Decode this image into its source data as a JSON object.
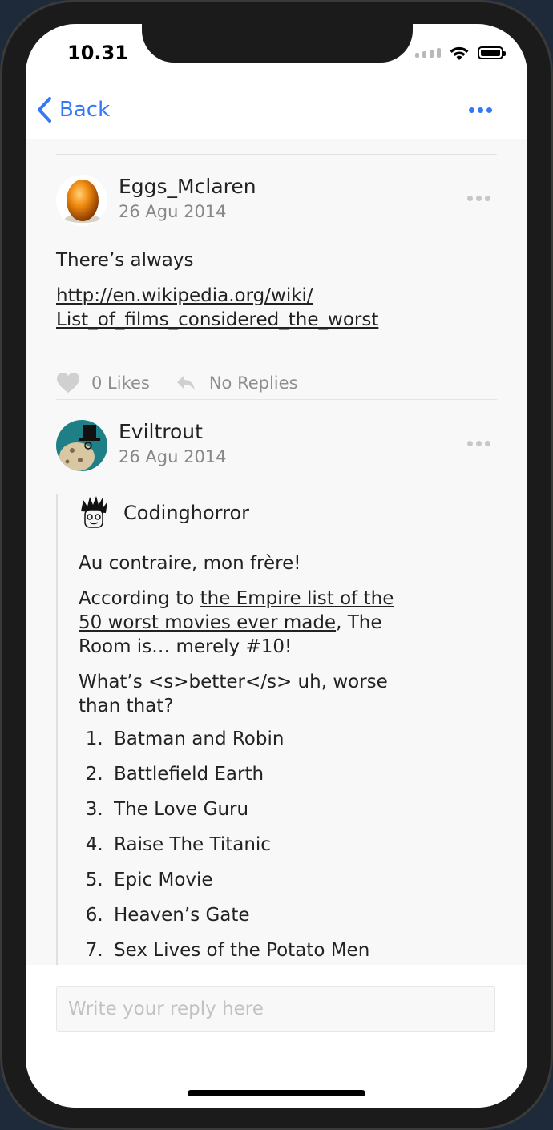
{
  "status_bar": {
    "time": "10.31"
  },
  "nav": {
    "back_label": "Back",
    "more_icon": "ellipsis-icon"
  },
  "posts": [
    {
      "author": "Eggs_Mclaren",
      "date": "26 Agu 2014",
      "text": "There’s always",
      "link_line1": "http://en.wikipedia.org/wiki/",
      "link_line2": "List_of_films_considered_the_worst",
      "likes": "0 Likes",
      "replies": "No Replies"
    },
    {
      "author": "Eviltrout",
      "date": "26 Agu 2014",
      "quote": {
        "author": "Codinghorror",
        "p1": "Au contraire, mon frère!",
        "p2_prefix": "According to ",
        "p2_link_line1": "the Empire list of the",
        "p2_link_line2": "50 worst movies ever made",
        "p2_suffix_line1": ", The",
        "p2_suffix_line2": "Room is… merely #10!",
        "p3_line1": "What’s <s>better</s> uh, worse",
        "p3_line2": "than that?",
        "list": [
          "Batman and Robin",
          "Battlefield Earth",
          "The Love Guru",
          "Raise The Titanic",
          "Epic Movie",
          "Heaven’s Gate",
          "Sex Lives of the Potato Men"
        ]
      }
    }
  ],
  "reply": {
    "placeholder": "Write your reply here"
  },
  "colors": {
    "accent": "#3478f6",
    "muted": "#8e8e8e",
    "background": "#f8f8f8"
  }
}
